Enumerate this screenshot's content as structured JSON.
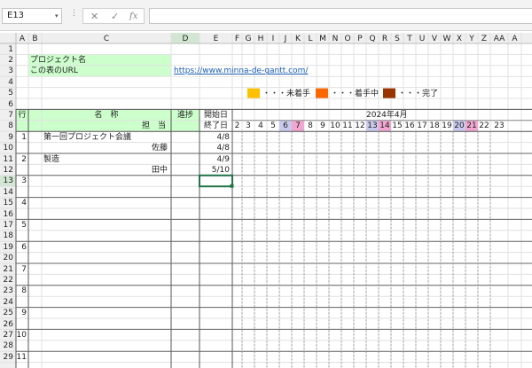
{
  "namebox": {
    "value": "E13"
  },
  "formula": {
    "cancel": "✕",
    "enter": "✓",
    "fx": "fx",
    "dots": "⋮",
    "drop": "▾"
  },
  "columns": [
    "A",
    "B",
    "C",
    "D",
    "E",
    "F",
    "G",
    "H",
    "I",
    "J",
    "K",
    "L",
    "M",
    "N",
    "O",
    "P",
    "Q",
    "R",
    "S",
    "T",
    "U",
    "V",
    "W",
    "X",
    "Y",
    "Z",
    "AA",
    "A"
  ],
  "rows": [
    "1",
    "2",
    "3",
    "4",
    "5",
    "6",
    "7",
    "8",
    "9",
    "10",
    "11",
    "12",
    "13",
    "14",
    "15",
    "16",
    "17",
    "18",
    "19",
    "20",
    "21",
    "22",
    "23",
    "24",
    "25",
    "26",
    "27",
    "28",
    "29"
  ],
  "project_label": "プロジェクト名",
  "url_label": "この表のURL",
  "url": "https://www.minna-de-gantt.com/",
  "legend": {
    "not_started": "・・・未着手",
    "in_progress": "・・・着手中",
    "done": "・・・完了",
    "colors": {
      "not_started": "#ffc000",
      "in_progress": "#ff6600",
      "done": "#993300"
    }
  },
  "header": {
    "row_label": "行",
    "name_label": "名　称",
    "person_label": "担　当",
    "progress_label": "進捗",
    "start_label": "開始日",
    "end_label": "終了日",
    "month": "2024年4月"
  },
  "days": [
    "2",
    "3",
    "4",
    "5",
    "6",
    "7",
    "8",
    "9",
    "10",
    "11",
    "12",
    "13",
    "14",
    "15",
    "16",
    "17",
    "18",
    "19",
    "20",
    "21",
    "22",
    "23"
  ],
  "day_highlight": {
    "6": "#c9c9ee",
    "7": "#f2a7d0",
    "13": "#c9c9ee",
    "14": "#f2a7d0",
    "20": "#c9c9ee",
    "21": "#f2a7d0"
  },
  "tasks": [
    {
      "no": "1",
      "name": "第一回プロジェクト会議",
      "person": "佐藤",
      "start": "4/8",
      "end": "4/8"
    },
    {
      "no": "2",
      "name": "製造",
      "person": "田中",
      "start": "4/9",
      "end": "5/10"
    },
    {
      "no": "3",
      "name": "",
      "person": "",
      "start": "",
      "end": ""
    },
    {
      "no": "4",
      "name": "",
      "person": "",
      "start": "",
      "end": ""
    },
    {
      "no": "5",
      "name": "",
      "person": "",
      "start": "",
      "end": ""
    },
    {
      "no": "6",
      "name": "",
      "person": "",
      "start": "",
      "end": ""
    },
    {
      "no": "7",
      "name": "",
      "person": "",
      "start": "",
      "end": ""
    },
    {
      "no": "8",
      "name": "",
      "person": "",
      "start": "",
      "end": ""
    },
    {
      "no": "9",
      "name": "",
      "person": "",
      "start": "",
      "end": ""
    },
    {
      "no": "10",
      "name": "",
      "person": "",
      "start": "",
      "end": ""
    },
    {
      "no": "11",
      "name": "",
      "person": "",
      "start": "",
      "end": ""
    }
  ]
}
